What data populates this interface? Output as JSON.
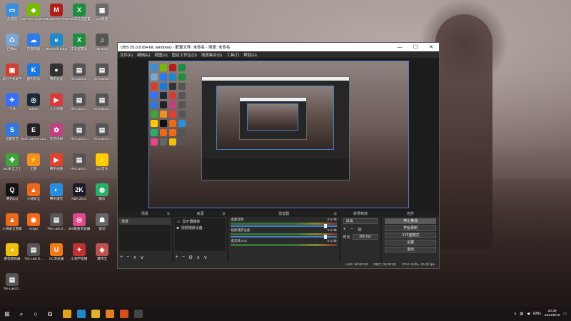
{
  "desktop": {
    "icons": [
      {
        "label": "此电脑",
        "color": "#3b8ed8",
        "glyph": "▭"
      },
      {
        "label": "GeForce Experience",
        "color": "#76b900",
        "glyph": "◆"
      },
      {
        "label": "MorphVOX Pro",
        "color": "#b0201a",
        "glyph": "M"
      },
      {
        "label": "OBS实验室配置表",
        "color": "#1f8c3f",
        "glyph": "X"
      },
      {
        "label": "QQ截图",
        "color": "#6a6a6a",
        "glyph": "▦"
      },
      {
        "label": "回收站",
        "color": "#7aa6d0",
        "glyph": "♺"
      },
      {
        "label": "百度网盘",
        "color": "#2b7ce9",
        "glyph": "☁"
      },
      {
        "label": "Microsoft Edge",
        "color": "#1e88c8",
        "glyph": "e"
      },
      {
        "label": "实验配置表",
        "color": "#1f8c3f",
        "glyph": "X"
      },
      {
        "label": "Mp3tag",
        "color": "#555555",
        "glyph": "♫"
      },
      {
        "label": "华为手机助手",
        "color": "#d04030",
        "glyph": "▣"
      },
      {
        "label": "酷狗音乐",
        "color": "#1a78e0",
        "glyph": "K"
      },
      {
        "label": "腾讯会议",
        "color": "#333333",
        "glyph": "●"
      },
      {
        "label": "The Last D...",
        "color": "#555555",
        "glyph": "▤"
      },
      {
        "label": "The Last D...",
        "color": "#555555",
        "glyph": "▤"
      },
      {
        "label": "飞书",
        "color": "#3370ff",
        "glyph": "✈"
      },
      {
        "label": "Steam",
        "color": "#1b2838",
        "glyph": "◎"
      },
      {
        "label": "人人视频",
        "color": "#d83a3a",
        "glyph": "▶"
      },
      {
        "label": "The Last D...",
        "color": "#555555",
        "glyph": "▤"
      },
      {
        "label": "The Last D...",
        "color": "#555555",
        "glyph": "▤"
      },
      {
        "label": "迅雷影音",
        "color": "#2b78e0",
        "glyph": "S"
      },
      {
        "label": "Epic Games Launcher",
        "color": "#222222",
        "glyph": "E"
      },
      {
        "label": "花花绿绿",
        "color": "#c04080",
        "glyph": "✿"
      },
      {
        "label": "The Last D...",
        "color": "#555555",
        "glyph": "▤"
      },
      {
        "label": "The Last D...",
        "color": "#555555",
        "glyph": "▤"
      },
      {
        "label": "360安全卫士",
        "color": "#3ca63c",
        "glyph": "✚"
      },
      {
        "label": "迅雷",
        "color": "#f09020",
        "glyph": "⚡"
      },
      {
        "label": "腾讯视频",
        "color": "#e04030",
        "glyph": "▶"
      },
      {
        "label": "The Last D...",
        "color": "#555555",
        "glyph": "▤"
      },
      {
        "label": "QQ音乐",
        "color": "#ffcc00",
        "glyph": "♪"
      },
      {
        "label": "腾讯QQ",
        "color": "#111111",
        "glyph": "Q"
      },
      {
        "label": "火绒安全",
        "color": "#e86a1a",
        "glyph": "▲"
      },
      {
        "label": "腾讯课堂",
        "color": "#2a8ee0",
        "glyph": "◐"
      },
      {
        "label": "NBA 2K21",
        "color": "#1a1a2a",
        "glyph": "2K"
      },
      {
        "label": "微信",
        "color": "#2aae67",
        "glyph": "◍"
      },
      {
        "label": "火绒安全管家",
        "color": "#e86a1a",
        "glyph": "▲"
      },
      {
        "label": "Origin",
        "color": "#f06a1a",
        "glyph": "◉"
      },
      {
        "label": "The Last D...",
        "color": "#555555",
        "glyph": "▤"
      },
      {
        "label": "360极速浏览器",
        "color": "#e04a8a",
        "glyph": "◎"
      },
      {
        "label": "驱动",
        "color": "#666666",
        "glyph": "☗"
      },
      {
        "label": "雷电模拟器",
        "color": "#f0c010",
        "glyph": "◕"
      },
      {
        "label": "The Last D...",
        "color": "#555555",
        "glyph": "▤"
      },
      {
        "label": "UC浏览器",
        "color": "#f07a1a",
        "glyph": "U"
      },
      {
        "label": "小葫芦直播",
        "color": "#c03030",
        "glyph": "✦"
      },
      {
        "label": "爆环出",
        "color": "#c05050",
        "glyph": "◈"
      },
      {
        "label": "The Last D...",
        "color": "#555555",
        "glyph": "▤"
      }
    ]
  },
  "obs": {
    "title": "OBS 25.0.8 (64-bit, windows) - 配置文件: 未命名 - 场景: 未命名",
    "window_controls": {
      "minimize": "—",
      "maximize": "☐",
      "close": "✕"
    },
    "menu": [
      "文件(F)",
      "编辑(E)",
      "视图(V)",
      "固定工作区(D)",
      "场景集合(S)",
      "工具(T)",
      "帮助(H)"
    ],
    "docks": {
      "scenes": {
        "title": "场景",
        "items": [
          "场景"
        ]
      },
      "sources": {
        "title": "来源",
        "items": [
          "显示器捕获",
          "视频捕获设备"
        ]
      },
      "mixer": {
        "title": "混音器",
        "tracks": [
          {
            "name": "桌面音频",
            "db": "0.0 dB"
          },
          {
            "name": "视频捕获设备",
            "db": "0.0 dB"
          },
          {
            "name": "麦克风/Aux",
            "db": "0.0 dB"
          }
        ]
      },
      "transitions": {
        "title": "转场特效",
        "type": "淡出",
        "duration_label": "时长",
        "duration": "300 ms"
      },
      "controls": {
        "title": "控件",
        "buttons": [
          "停止推流",
          "开始录制",
          "工作室模式",
          "设置",
          "退出"
        ]
      }
    },
    "status": {
      "live": "LIVE: 00:00:00",
      "rec": "REC: 00:00:00",
      "cpu": "CPU: 0.0%, 30.00 fps"
    }
  },
  "taskbar": {
    "start": "⊞",
    "search": "⌕",
    "cortana": "○",
    "taskview": "⧉",
    "apps": [
      {
        "name": "chrome",
        "color": "#e0a020"
      },
      {
        "name": "edge",
        "color": "#1e88c8"
      },
      {
        "name": "explorer",
        "color": "#e0b030"
      },
      {
        "name": "app-orange",
        "color": "#e08020"
      },
      {
        "name": "app-red",
        "color": "#d05020"
      },
      {
        "name": "obs",
        "color": "#444444"
      }
    ],
    "tray": {
      "lang": "ENG",
      "time": "20:39",
      "date": "2021/8/19"
    }
  }
}
